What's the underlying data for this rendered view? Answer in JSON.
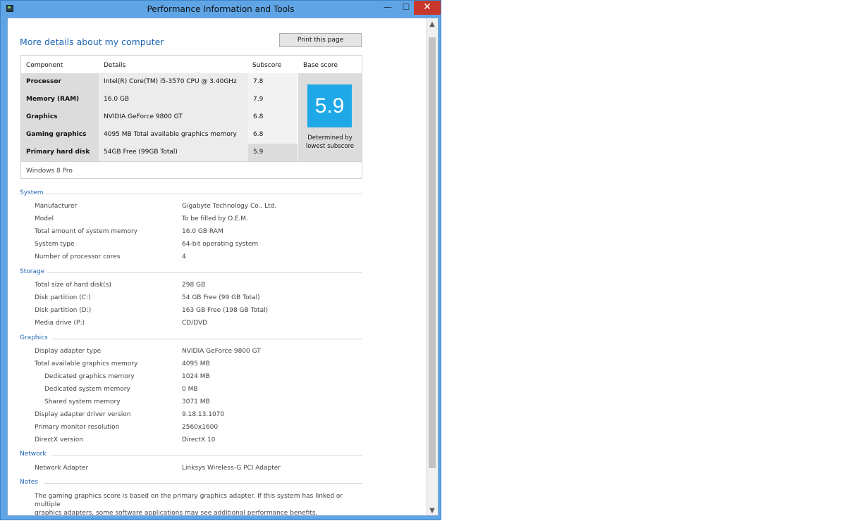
{
  "window": {
    "title": "Performance Information and Tools",
    "minimize": "—",
    "maximize": "☐",
    "close": "✕"
  },
  "heading": "More details about my computer",
  "print_button": "Print this page",
  "score_table": {
    "headers": {
      "component": "Component",
      "details": "Details",
      "subscore": "Subscore",
      "base": "Base score"
    },
    "rows": [
      {
        "component": "Processor",
        "details": "Intel(R) Core(TM) i5-3570 CPU @ 3.40GHz",
        "subscore": "7.8"
      },
      {
        "component": "Memory (RAM)",
        "details": "16.0 GB",
        "subscore": "7.9"
      },
      {
        "component": "Graphics",
        "details": "NVIDIA GeForce 9800 GT",
        "subscore": "6.8"
      },
      {
        "component": "Gaming graphics",
        "details": "4095 MB Total available graphics memory",
        "subscore": "6.8"
      },
      {
        "component": "Primary hard disk",
        "details": "54GB Free (99GB Total)",
        "subscore": "5.9"
      }
    ],
    "base_score": "5.9",
    "base_note_line1": "Determined by",
    "base_note_line2": "lowest subscore",
    "os": "Windows 8 Pro"
  },
  "system": {
    "title": "System",
    "items": [
      {
        "label": "Manufacturer",
        "value": "Gigabyte Technology Co., Ltd."
      },
      {
        "label": "Model",
        "value": "To be filled by O.E.M."
      },
      {
        "label": "Total amount of system memory",
        "value": "16.0 GB RAM"
      },
      {
        "label": "System type",
        "value": "64-bit operating system"
      },
      {
        "label": "Number of processor cores",
        "value": "4"
      }
    ]
  },
  "storage": {
    "title": "Storage",
    "items": [
      {
        "label": "Total size of hard disk(s)",
        "value": "298 GB"
      },
      {
        "label": "Disk partition (C:)",
        "value": "54 GB Free (99 GB Total)"
      },
      {
        "label": "Disk partition (D:)",
        "value": "163 GB Free (198 GB Total)"
      },
      {
        "label": "Media drive (P:)",
        "value": "CD/DVD"
      }
    ]
  },
  "graphics": {
    "title": "Graphics",
    "items": [
      {
        "label": "Display adapter type",
        "value": "NVIDIA GeForce 9800 GT"
      },
      {
        "label": "Total available graphics memory",
        "value": "4095 MB"
      },
      {
        "label": "Dedicated graphics memory",
        "value": "1024 MB"
      },
      {
        "label": "Dedicated system memory",
        "value": "0 MB"
      },
      {
        "label": "Shared system memory",
        "value": "3071 MB"
      },
      {
        "label": "Display adapter driver version",
        "value": "9.18.13.1070"
      },
      {
        "label": "Primary monitor resolution",
        "value": "2560x1600"
      },
      {
        "label": "DirectX version",
        "value": "DirectX 10"
      }
    ]
  },
  "network": {
    "title": "Network",
    "items": [
      {
        "label": "Network Adapter",
        "value": "Linksys Wireless-G PCI Adapter"
      }
    ]
  },
  "notes": {
    "title": "Notes",
    "line1": "The gaming graphics score is based on the primary graphics adapter. If this system has linked or multiple",
    "line2": "graphics adapters, some software applications may see additional performance benefits."
  },
  "scrollbar": {
    "up": "▲",
    "down": "▼"
  }
}
